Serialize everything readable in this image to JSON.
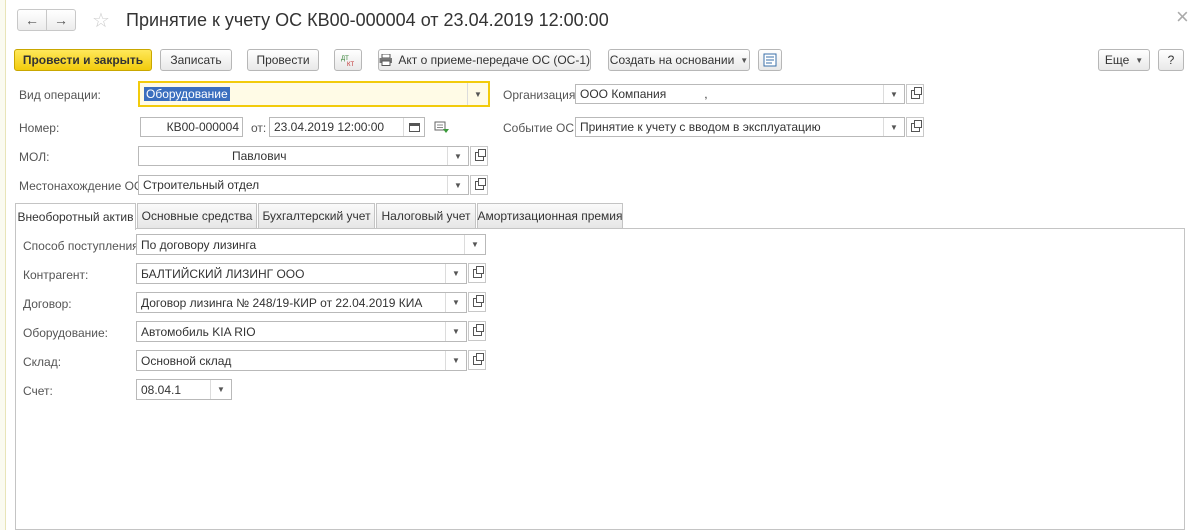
{
  "title": "Принятие к учету ОС КВ00-000004 от 23.04.2019 12:00:00",
  "toolbar": {
    "post_close": "Провести и закрыть",
    "save": "Записать",
    "post": "Провести",
    "dtkt": "Дт Кт",
    "act": "Акт о приеме-передаче ОС (ОС-1)",
    "create_based": "Создать на основании",
    "more": "Еще",
    "help": "?"
  },
  "form": {
    "op_type_label": "Вид операции:",
    "op_type_value": "Оборудование",
    "org_label": "Организация:",
    "org_value": "ООО Компания",
    "org_suffix": ",",
    "number_label": "Номер:",
    "number_value": "КВ00-000004",
    "from_label": "от:",
    "date_value": "23.04.2019 12:00:00",
    "event_label": "Событие ОС:",
    "event_value": "Принятие к учету с вводом в эксплуатацию",
    "mol_label": "МОЛ:",
    "mol_value": "Павлович",
    "location_label": "Местонахождение ОС:",
    "location_value": "Строительный отдел"
  },
  "tabs": [
    "Внеоборотный актив",
    "Основные средства",
    "Бухгалтерский учет",
    "Налоговый учет",
    "Амортизационная премия"
  ],
  "asset": {
    "receipt_label": "Способ поступления:",
    "receipt_value": "По договору лизинга",
    "counterparty_label": "Контрагент:",
    "counterparty_value": "БАЛТИЙСКИЙ ЛИЗИНГ ООО",
    "contract_label": "Договор:",
    "contract_value": "Договор лизинга № 248/19-КИР от 22.04.2019 КИА",
    "equipment_label": "Оборудование:",
    "equipment_value": "Автомобиль KIA RIO",
    "warehouse_label": "Склад:",
    "warehouse_value": "Основной склад",
    "account_label": "Счет:",
    "account_value": "08.04.1"
  }
}
